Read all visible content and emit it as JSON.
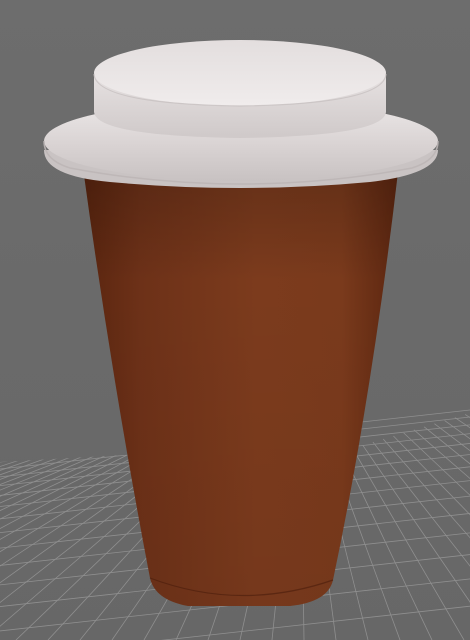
{
  "viewport": {
    "background_color": "#6f6f6f",
    "grid_visible": true,
    "grid_line_color": "#8f8f8f",
    "grid_fill_color": "#6c6c6c"
  },
  "model": {
    "object": "cup-with-lid",
    "cup_color": "#6e3219",
    "cup_highlight_color": "#8a4426",
    "cup_shadow_color": "#3f1a0b",
    "lid_color": "#d9d4d4",
    "lid_highlight_color": "#ede9e9",
    "lid_shadow_color": "#a9a3a3"
  }
}
